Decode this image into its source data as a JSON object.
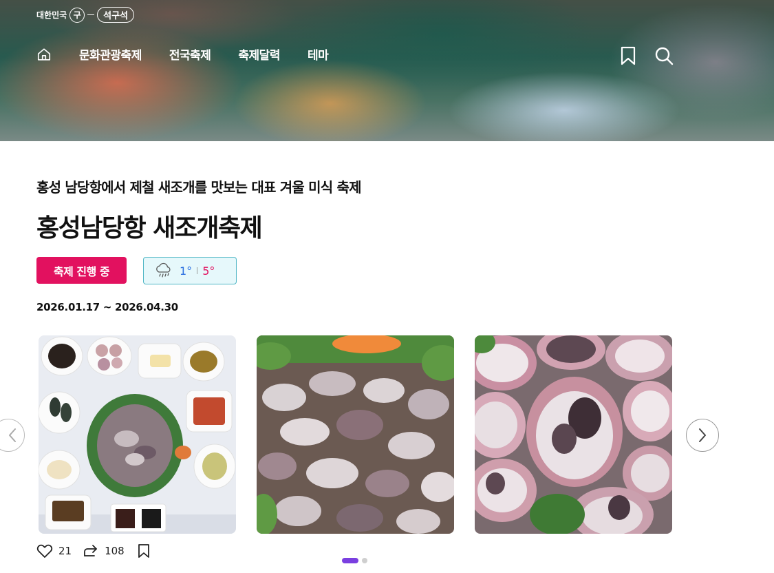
{
  "brand": {
    "prefix": "대한민국",
    "mark": "구",
    "name": "석구석"
  },
  "nav": {
    "items": [
      {
        "label": "문화관광축제"
      },
      {
        "label": "전국축제"
      },
      {
        "label": "축제달력"
      },
      {
        "label": "테마"
      }
    ]
  },
  "festival": {
    "subtitle": "홍성 남당항에서 제철 새조개를 맛보는 대표 겨울 미식 축제",
    "title": "홍성남당항 새조개축제",
    "status": "축제 진행 중",
    "weather": {
      "icon": "rain-cloud-icon",
      "low": "1°",
      "high": "5°"
    },
    "dates": "2026.01.17 ~ 2026.04.30"
  },
  "stats": {
    "likes": "21",
    "shares": "108"
  },
  "carousel": {
    "page": 1,
    "pages": 2
  },
  "colors": {
    "accent": "#e2115f",
    "low_temp": "#2b6fe0",
    "dot_active": "#7a3fe0"
  }
}
